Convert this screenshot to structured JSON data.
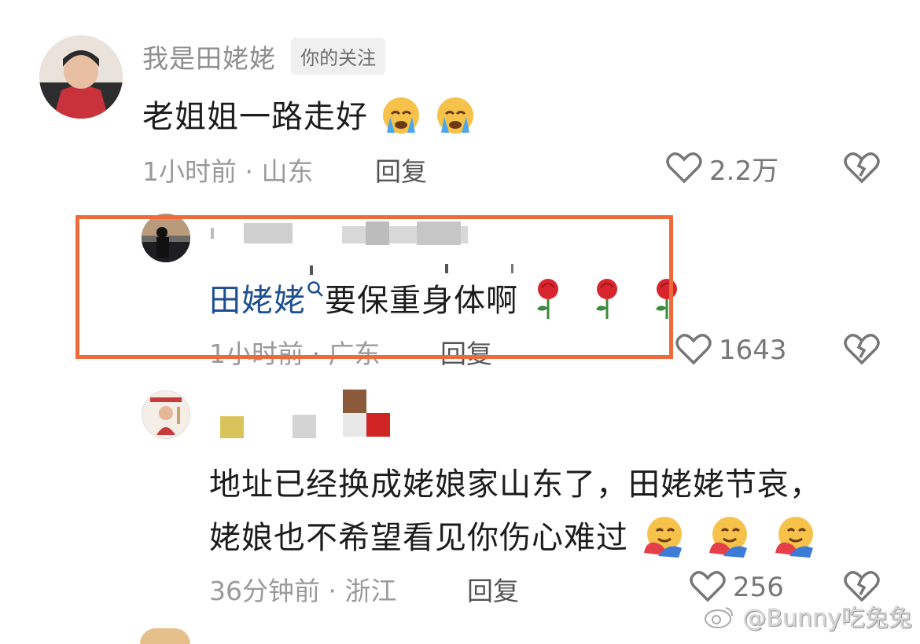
{
  "comments": [
    {
      "username": "我是田姥姥",
      "tag": "你的关注",
      "content": "老姐姐一路走好",
      "emoji": [
        "crying-face",
        "crying-face"
      ],
      "time_location": "1小时前 · 山东",
      "reply_label": "回复",
      "likes": "2.2万"
    },
    {
      "mention": "田姥姥",
      "content": "要保重身体啊",
      "emoji": [
        "rose",
        "rose",
        "rose"
      ],
      "time_location": "1小时前 · 广东",
      "reply_label": "回复",
      "likes": "1643"
    },
    {
      "content_line1": "地址已经换成姥娘家山东了，田姥姥节哀，",
      "content_line2": "姥娘也不希望看见你伤心难过",
      "emoji": [
        "hugging-face",
        "hugging-face",
        "hugging-face"
      ],
      "time_location": "36分钟前 · 浙江",
      "reply_label": "回复",
      "likes": "256"
    }
  ],
  "watermark": "@Bunny吃兔兔",
  "colors": {
    "highlight_border": "#ef6a3a",
    "mention": "#1d4f91",
    "meta": "#9a9a9a"
  }
}
